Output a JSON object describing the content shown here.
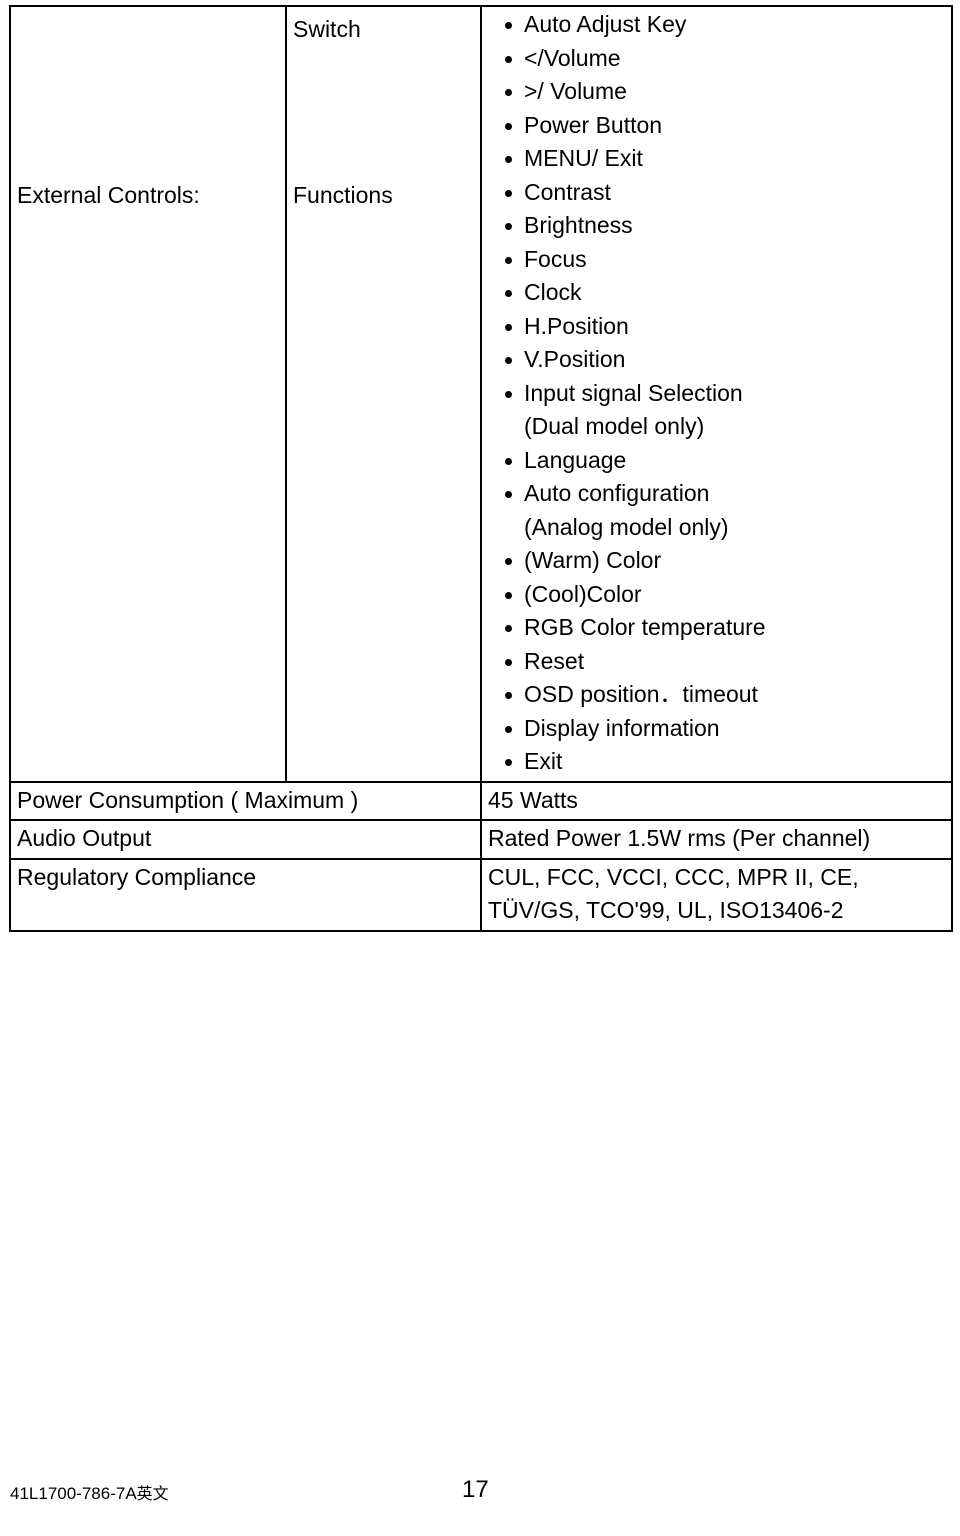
{
  "document": {
    "table": {
      "external_controls": {
        "label": "External Controls:",
        "switch_label": "Switch",
        "functions_label": "Functions",
        "switch_items": [
          "Auto Adjust Key",
          "</Volume",
          ">/ Volume",
          "Power Button",
          "MENU/ Exit"
        ],
        "function_items": [
          "Contrast",
          "Brightness",
          "Focus",
          "Clock",
          "H.Position",
          "V.Position",
          "Input signal Selection",
          "(Dual model only)",
          "Language",
          "Auto configuration",
          "(Analog model only)",
          "(Warm) Color",
          "(Cool)Color",
          "RGB Color temperature",
          "Reset",
          "OSD position．timeout",
          "Display information",
          "Exit"
        ],
        "function_item_flags": [
          true,
          true,
          true,
          true,
          true,
          true,
          true,
          false,
          true,
          true,
          false,
          true,
          true,
          true,
          true,
          true,
          true,
          true
        ]
      },
      "rows": [
        {
          "label": "Power Consumption   ( Maximum )",
          "value": "45 Watts"
        },
        {
          "label": "Audio Output",
          "value": "Rated Power 1.5W rms (Per channel)"
        },
        {
          "label": "Regulatory Compliance",
          "value_line1": "CUL, FCC, VCCI, CCC, MPR II, CE,",
          "value_line2": "TÜV/GS, TCO'99, UL, ISO13406-2"
        }
      ]
    },
    "footer": {
      "doc_code": "41L1700-786-7A",
      "doc_code_suffix": "英文",
      "page_number": "17"
    }
  }
}
